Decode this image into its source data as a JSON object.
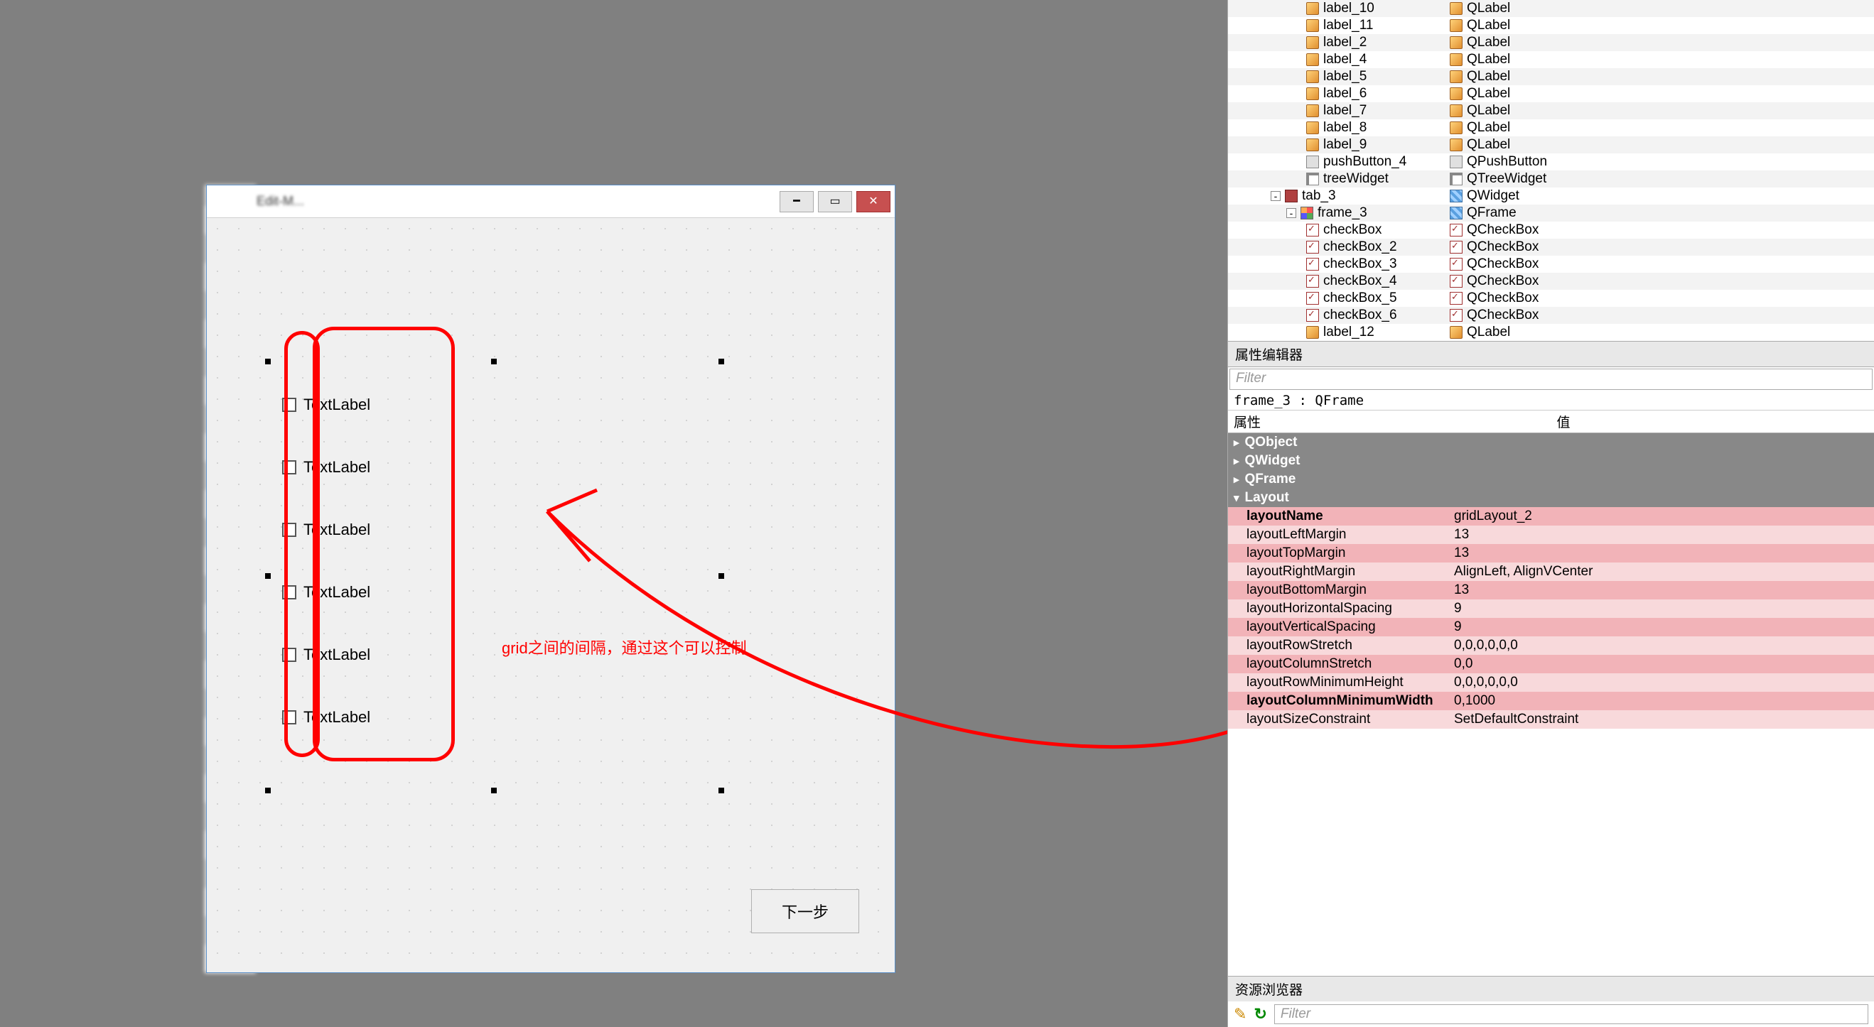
{
  "dialog": {
    "title_blurred": "Edit-M...",
    "checkboxes": [
      {
        "label": "TextLabel"
      },
      {
        "label": "TextLabel"
      },
      {
        "label": "TextLabel"
      },
      {
        "label": "TextLabel"
      },
      {
        "label": "TextLabel"
      },
      {
        "label": "TextLabel"
      }
    ],
    "next_button": "下一步"
  },
  "annotation": {
    "text": "grid之间的间隔，通过这个可以控制"
  },
  "object_tree": {
    "rows": [
      {
        "indent": 110,
        "name": "label_10",
        "cls": "QLabel",
        "nico": "ico-label",
        "cico": "ico-label"
      },
      {
        "indent": 110,
        "name": "label_11",
        "cls": "QLabel",
        "nico": "ico-label",
        "cico": "ico-label"
      },
      {
        "indent": 110,
        "name": "label_2",
        "cls": "QLabel",
        "nico": "ico-label",
        "cico": "ico-label"
      },
      {
        "indent": 110,
        "name": "label_4",
        "cls": "QLabel",
        "nico": "ico-label",
        "cico": "ico-label"
      },
      {
        "indent": 110,
        "name": "label_5",
        "cls": "QLabel",
        "nico": "ico-label",
        "cico": "ico-label"
      },
      {
        "indent": 110,
        "name": "label_6",
        "cls": "QLabel",
        "nico": "ico-label",
        "cico": "ico-label"
      },
      {
        "indent": 110,
        "name": "label_7",
        "cls": "QLabel",
        "nico": "ico-label",
        "cico": "ico-label"
      },
      {
        "indent": 110,
        "name": "label_8",
        "cls": "QLabel",
        "nico": "ico-label",
        "cico": "ico-label"
      },
      {
        "indent": 110,
        "name": "label_9",
        "cls": "QLabel",
        "nico": "ico-label",
        "cico": "ico-label"
      },
      {
        "indent": 110,
        "name": "pushButton_4",
        "cls": "QPushButton",
        "nico": "ico-btn",
        "cico": "ico-btn"
      },
      {
        "indent": 110,
        "name": "treeWidget",
        "cls": "QTreeWidget",
        "nico": "ico-tree",
        "cico": "ico-tree"
      },
      {
        "indent": 60,
        "name": "tab_3",
        "cls": "QWidget",
        "nico": "ico-tab",
        "cico": "ico-qwidget",
        "expander": "-"
      },
      {
        "indent": 82,
        "name": "frame_3",
        "cls": "QFrame",
        "nico": "ico-grid",
        "cico": "ico-frame",
        "expander": "-"
      },
      {
        "indent": 110,
        "name": "checkBox",
        "cls": "QCheckBox",
        "nico": "ico-check",
        "cico": "ico-check"
      },
      {
        "indent": 110,
        "name": "checkBox_2",
        "cls": "QCheckBox",
        "nico": "ico-check",
        "cico": "ico-check"
      },
      {
        "indent": 110,
        "name": "checkBox_3",
        "cls": "QCheckBox",
        "nico": "ico-check",
        "cico": "ico-check"
      },
      {
        "indent": 110,
        "name": "checkBox_4",
        "cls": "QCheckBox",
        "nico": "ico-check",
        "cico": "ico-check"
      },
      {
        "indent": 110,
        "name": "checkBox_5",
        "cls": "QCheckBox",
        "nico": "ico-check",
        "cico": "ico-check"
      },
      {
        "indent": 110,
        "name": "checkBox_6",
        "cls": "QCheckBox",
        "nico": "ico-check",
        "cico": "ico-check"
      },
      {
        "indent": 110,
        "name": "label_12",
        "cls": "QLabel",
        "nico": "ico-label",
        "cico": "ico-label"
      }
    ]
  },
  "property_editor": {
    "title": "属性编辑器",
    "filter_placeholder": "Filter",
    "object_line": "frame_3 : QFrame",
    "head_prop": "属性",
    "head_val": "值",
    "groups": [
      "QObject",
      "QWidget",
      "QFrame"
    ],
    "layout_group": "Layout",
    "props": [
      {
        "k": "layoutName",
        "v": "gridLayout_2",
        "style": "pink-dark bold"
      },
      {
        "k": "layoutLeftMargin",
        "v": "13",
        "style": "pink-light"
      },
      {
        "k": "layoutTopMargin",
        "v": "13",
        "style": "pink-dark"
      },
      {
        "k": "layoutRightMargin",
        "v": "AlignLeft, AlignVCenter",
        "style": "pink-light"
      },
      {
        "k": "layoutBottomMargin",
        "v": "13",
        "style": "pink-dark"
      },
      {
        "k": "layoutHorizontalSpacing",
        "v": "9",
        "style": "pink-light"
      },
      {
        "k": "layoutVerticalSpacing",
        "v": "9",
        "style": "pink-dark"
      },
      {
        "k": "layoutRowStretch",
        "v": "0,0,0,0,0,0",
        "style": "pink-light bold"
      },
      {
        "k": "layoutColumnStretch",
        "v": "0,0",
        "style": "pink-dark"
      },
      {
        "k": "layoutRowMinimumHeight",
        "v": "0,0,0,0,0,0",
        "style": "pink-light bold"
      },
      {
        "k": "layoutColumnMinimumWidth",
        "v": "0,1000",
        "style": "pink-dark bold"
      },
      {
        "k": "layoutSizeConstraint",
        "v": "SetDefaultConstraint",
        "style": "pink-light bold"
      }
    ]
  },
  "resource_browser": {
    "title": "资源浏览器",
    "filter_placeholder": "Filter"
  }
}
